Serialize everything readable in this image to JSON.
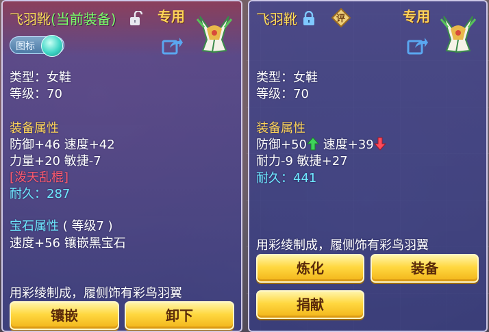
{
  "left_panel": {
    "title_name": "飞羽靴",
    "title_status": "(当前装备)",
    "special_label": "专用",
    "toggle_label": "图标",
    "type_line": "类型：女鞋",
    "level_line": "等级：70",
    "attr_heading": "装备属性",
    "stat_line1": "防御+46 速度+42",
    "stat_line2": "力量+20 敏捷-7",
    "special_skill": "[泼天乱棍]",
    "durability_label": "耐久：",
    "durability_value": "287",
    "gem_heading": "宝石属性",
    "gem_level": "( 等级7 )",
    "gem_line": "速度+56 镶嵌黑宝石",
    "description": "用彩绫制成，履侧饰有彩鸟羽翼",
    "buttons": {
      "inlay": "镶嵌",
      "unequip": "卸下"
    }
  },
  "right_panel": {
    "title_name": "飞羽靴",
    "rate_badge": "评",
    "special_label": "专用",
    "type_line": "类型：女鞋",
    "level_line": "等级：70",
    "attr_heading": "装备属性",
    "stat_def": "防御+50",
    "stat_speed": "速度+39",
    "stat_line2": "耐力-9 敏捷+27",
    "durability_label": "耐久：",
    "durability_value": "441",
    "description": "用彩绫制成，履侧饰有彩鸟羽翼",
    "buttons": {
      "refine": "炼化",
      "equip": "装备",
      "donate": "捐献"
    }
  },
  "colors": {
    "title": "#ffe05a",
    "equipped": "#7dff6a",
    "heading": "#ffd55a",
    "skill_red": "#ff5a6e",
    "durability_cyan": "#6fe9ff",
    "button_gold": "#ffd840"
  },
  "icons": [
    "lock-open-icon",
    "lock-closed-icon",
    "share-icon",
    "boot-item-icon",
    "arrow-up-icon",
    "arrow-down-icon"
  ]
}
